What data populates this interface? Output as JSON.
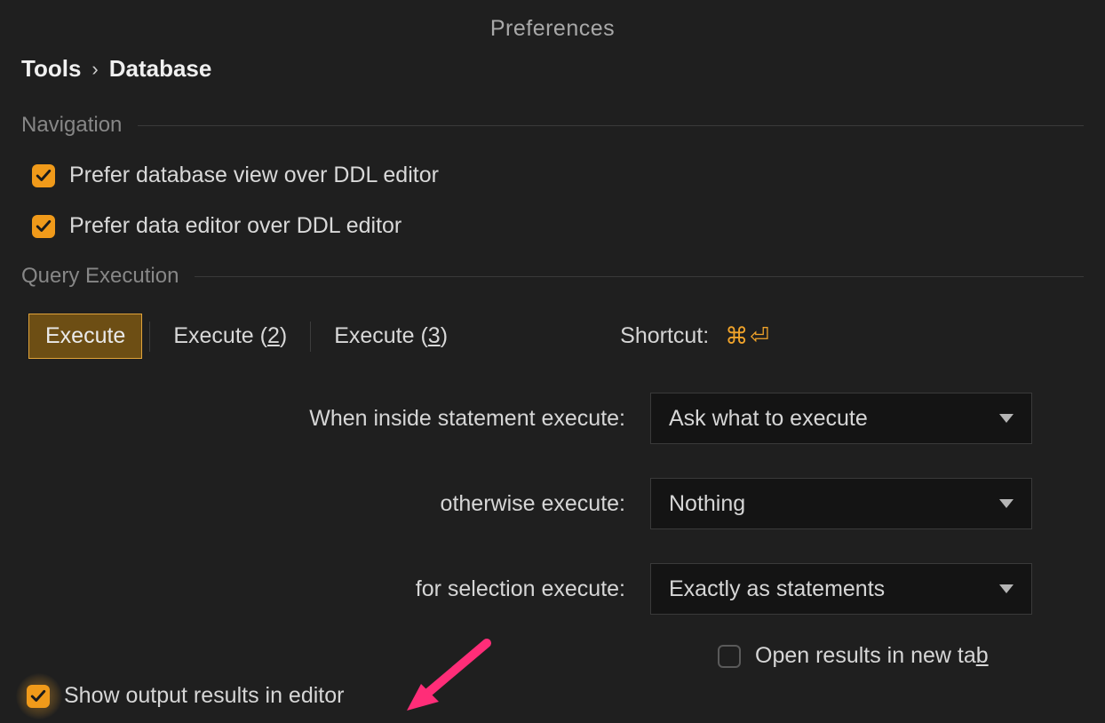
{
  "window": {
    "title": "Preferences"
  },
  "breadcrumb": {
    "root": "Tools",
    "current": "Database"
  },
  "sections": {
    "navigation": {
      "title": "Navigation",
      "opts": [
        {
          "checked": true,
          "label": "Prefer database view over DDL editor"
        },
        {
          "checked": true,
          "label": "Prefer data editor over DDL editor"
        }
      ]
    },
    "query_exec": {
      "title": "Query Execution",
      "tabs": {
        "t0": "Execute",
        "t1_prefix": "Execute (",
        "t1_key": "2",
        "t1_suffix": ")",
        "t2_prefix": "Execute (",
        "t2_key": "3",
        "t2_suffix": ")"
      },
      "shortcut_label": "Shortcut:",
      "shortcut_keys": "⌘⏎",
      "rows": {
        "inside_label": "When inside statement execute:",
        "inside_value": "Ask what to execute",
        "otherwise_label": "otherwise execute:",
        "otherwise_value": "Nothing",
        "selection_label": "for selection execute:",
        "selection_value": "Exactly as statements"
      },
      "open_results": {
        "checked": false,
        "label_prefix": "Open results in new ta",
        "label_key": "b"
      },
      "show_output": {
        "checked": true,
        "label": "Show output results in editor"
      }
    }
  },
  "colors": {
    "accent": "#f09a1a",
    "annotation": "#ff2d78"
  }
}
